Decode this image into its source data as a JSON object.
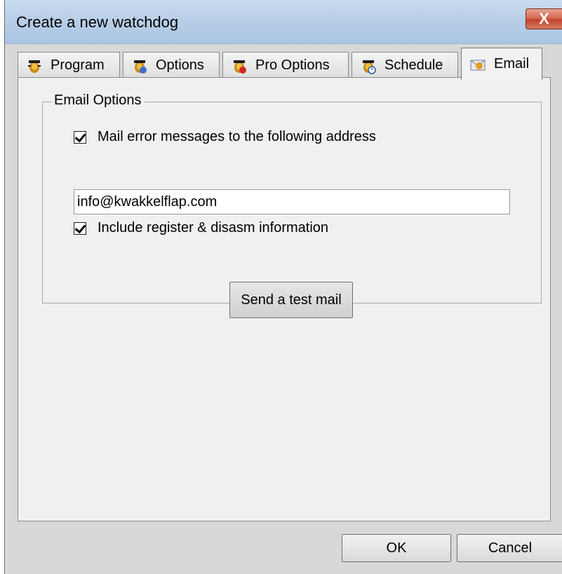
{
  "window": {
    "title": "Create a new watchdog",
    "close_label": "X"
  },
  "tabs": [
    {
      "label": "Program",
      "icon": "watchdog-icon",
      "active": false
    },
    {
      "label": "Options",
      "icon": "watchdog-options-icon",
      "active": false
    },
    {
      "label": "Pro Options",
      "icon": "watchdog-pro-icon",
      "active": false
    },
    {
      "label": "Schedule",
      "icon": "schedule-icon",
      "active": false
    },
    {
      "label": "Email",
      "icon": "email-icon",
      "active": true
    }
  ],
  "email_options": {
    "group_title": "Email Options",
    "mail_errors": {
      "label": "Mail error messages to the following address",
      "checked": true
    },
    "address": {
      "value": "info@kwakkelflap.com"
    },
    "include_register": {
      "label": "Include register & disasm information",
      "checked": true
    },
    "test_button": "Send a test mail"
  },
  "footer": {
    "ok_label": "OK",
    "cancel_label": "Cancel"
  },
  "colors": {
    "titlebar": "#b9cfe7",
    "close_button": "#c0432c",
    "panel": "#f0f0f0",
    "frame": "#d8d8d8"
  }
}
